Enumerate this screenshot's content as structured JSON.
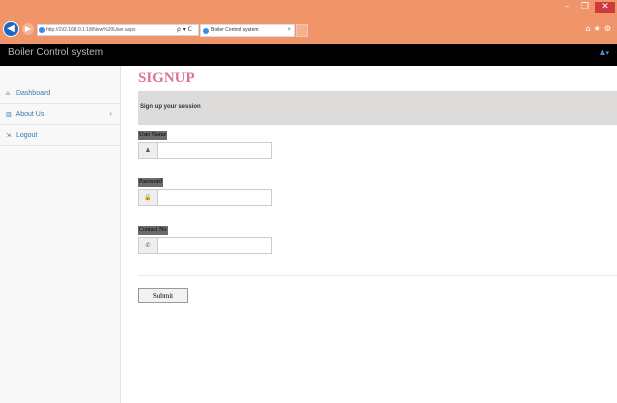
{
  "browser": {
    "url": "http://192.168.0.1:18/New%20User.aspx",
    "address_tools": "ρ ▾ C",
    "tab_title": "Boiler Control system",
    "tab_close": "×",
    "window_minimize": "–",
    "window_restore": "❐",
    "window_close": "✕",
    "chrome_icons": "⌂★⚙"
  },
  "app": {
    "brand": "Boiler Control system",
    "user_menu": "♟▾"
  },
  "sidebar": {
    "items": [
      {
        "label": "Dashboard",
        "icon": "dashboard-icon",
        "glyph": "⌂"
      },
      {
        "label": "About Us",
        "icon": "bar-chart-icon",
        "glyph": "▥",
        "chevron": "‹"
      },
      {
        "label": "Logout",
        "icon": "logout-icon",
        "glyph": "⇲"
      }
    ]
  },
  "main": {
    "title": "SIGNUP",
    "banner": "Sign up your session",
    "fields": [
      {
        "label": "User Name",
        "icon": "user-icon",
        "glyph": "♟",
        "value": ""
      },
      {
        "label": "Password",
        "icon": "lock-icon",
        "glyph": "🔒",
        "value": ""
      },
      {
        "label": "Contact No",
        "icon": "phone-icon",
        "glyph": "✆",
        "value": ""
      }
    ],
    "submit_label": "Submit"
  },
  "colors": {
    "chrome": "#f0946a",
    "appbar": "#000000",
    "title": "#d9739b",
    "link": "#337ab7",
    "banner": "#dedbdb"
  }
}
